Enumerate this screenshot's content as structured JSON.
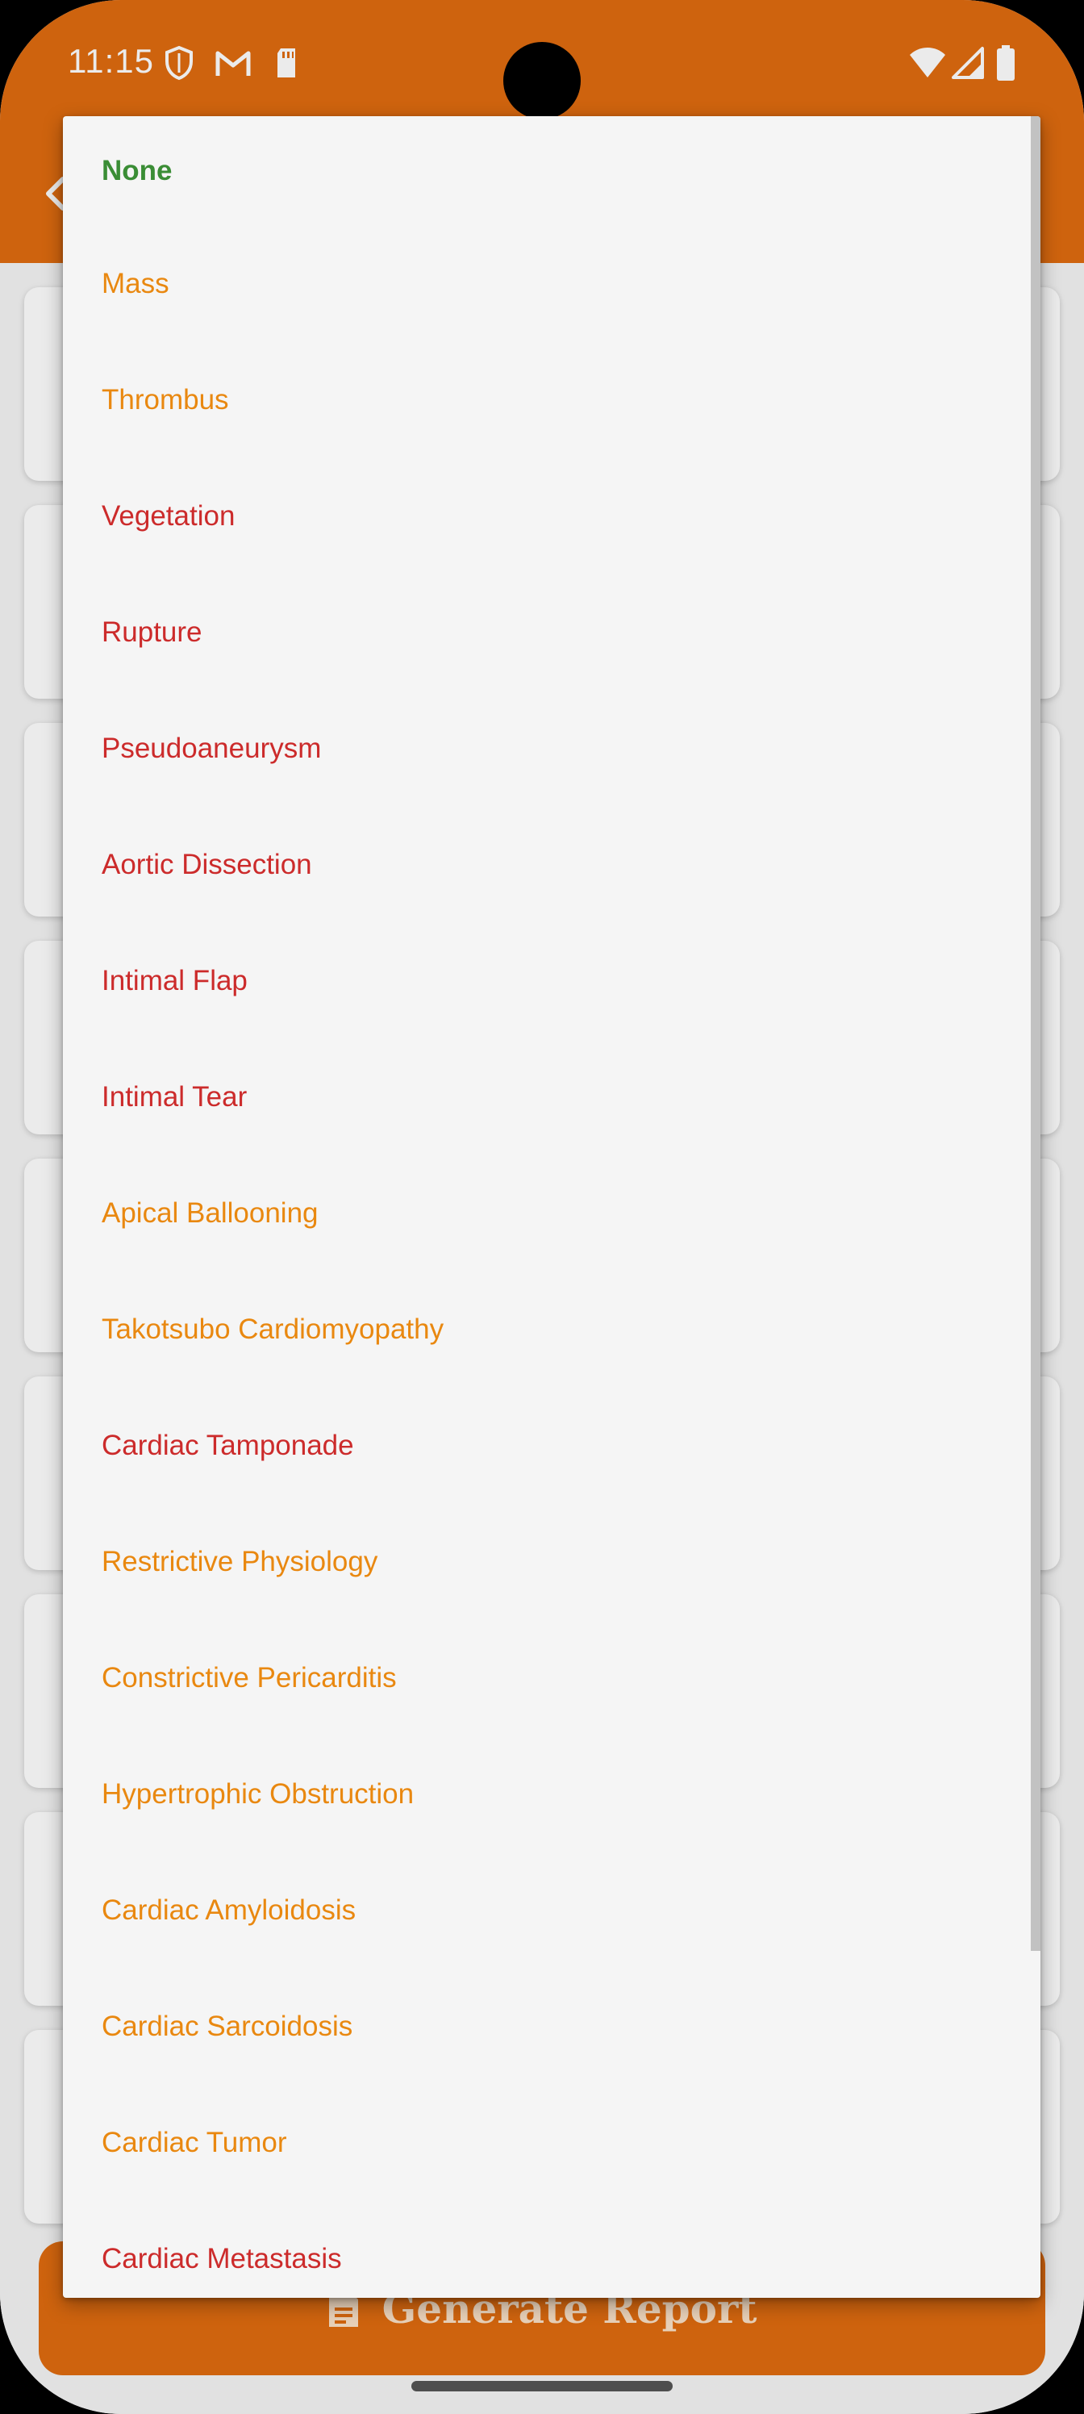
{
  "status_bar": {
    "time": "11:15"
  },
  "icons": {
    "shield": "shield-icon",
    "gmail": "gmail-icon",
    "sd_card": "sd-card-icon",
    "wifi": "wifi-icon",
    "signal": "signal-icon",
    "battery": "battery-icon",
    "back": "back-arrow-icon",
    "report": "report-icon"
  },
  "colors": {
    "brand": "#e06c10",
    "safe": "#3a8d35",
    "warning": "#e98810",
    "critical": "#cc2b2b"
  },
  "dropdown": {
    "options": [
      {
        "label": "None",
        "severity": "safe"
      },
      {
        "label": "Mass",
        "severity": "warning"
      },
      {
        "label": "Thrombus",
        "severity": "warning"
      },
      {
        "label": "Vegetation",
        "severity": "critical"
      },
      {
        "label": "Rupture",
        "severity": "critical"
      },
      {
        "label": "Pseudoaneurysm",
        "severity": "critical"
      },
      {
        "label": "Aortic Dissection",
        "severity": "critical"
      },
      {
        "label": "Intimal Flap",
        "severity": "critical"
      },
      {
        "label": "Intimal Tear",
        "severity": "critical"
      },
      {
        "label": "Apical Ballooning",
        "severity": "warning"
      },
      {
        "label": "Takotsubo Cardiomyopathy",
        "severity": "warning"
      },
      {
        "label": "Cardiac Tamponade",
        "severity": "critical"
      },
      {
        "label": "Restrictive Physiology",
        "severity": "warning"
      },
      {
        "label": "Constrictive Pericarditis",
        "severity": "warning"
      },
      {
        "label": "Hypertrophic Obstruction",
        "severity": "warning"
      },
      {
        "label": "Cardiac Amyloidosis",
        "severity": "warning"
      },
      {
        "label": "Cardiac Sarcoidosis",
        "severity": "warning"
      },
      {
        "label": "Cardiac Tumor",
        "severity": "warning"
      },
      {
        "label": "Cardiac Metastasis",
        "severity": "critical"
      }
    ]
  },
  "footer": {
    "generate_label": "Generate Report"
  }
}
